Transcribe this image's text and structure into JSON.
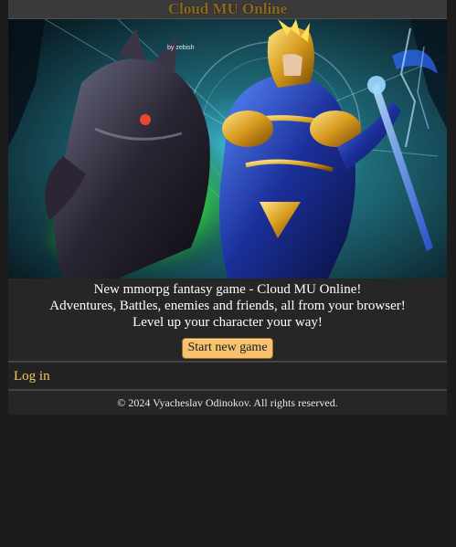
{
  "header": {
    "title": "Cloud MU Online"
  },
  "hero": {
    "artist_credit": "by zebish"
  },
  "intro": {
    "line1": "New mmorpg fantasy game - Cloud MU Online!",
    "line2": "Adventures, Battles, enemies and friends, all from your browser!",
    "line3": "Level up your character your way!",
    "start_button": "Start new game"
  },
  "nav": {
    "login": "Log in"
  },
  "footer": {
    "copyright": "© 2024 Vyacheslav Odinokov. All rights reserved."
  },
  "colors": {
    "page_background": "#1c1c1c",
    "header_background": "#3a3a3a",
    "title_text": "#8a6a1c",
    "button_background": "#f6c26f",
    "link_text": "#f4c667"
  }
}
